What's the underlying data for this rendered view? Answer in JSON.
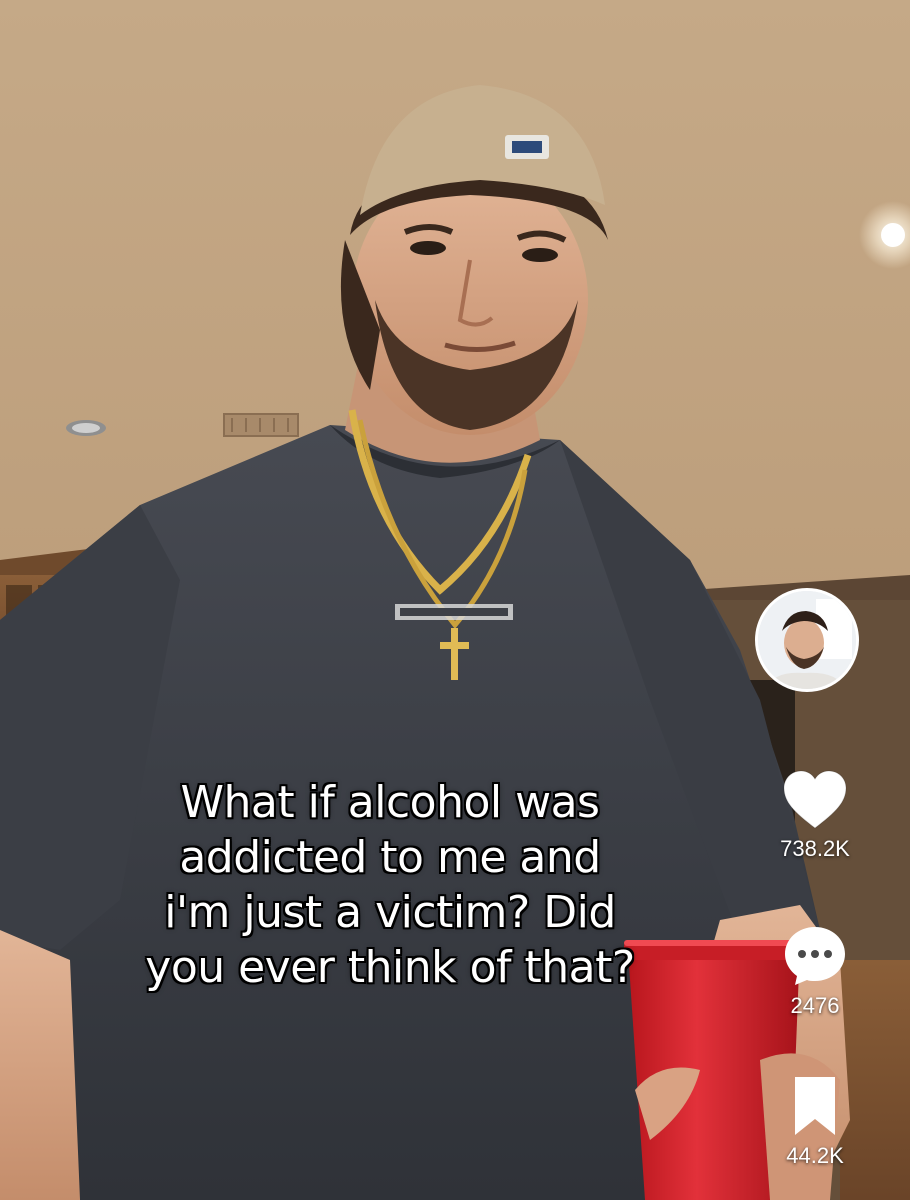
{
  "video": {
    "caption_lines": [
      "What if alcohol was",
      "addicted to me and",
      "i'm just a victim? Did",
      "you ever think of that?"
    ]
  },
  "rail": {
    "like": {
      "icon": "heart-icon",
      "count": "738.2K"
    },
    "comment": {
      "icon": "comment-bubble-icon",
      "count": "2476"
    },
    "save": {
      "icon": "bookmark-icon",
      "count": "44.2K"
    }
  },
  "colors": {
    "ceiling": "#c9ae8e",
    "shirt": "#3d4047",
    "cup": "#d8232a",
    "caption_text": "#ffffff",
    "caption_outline": "#000000"
  }
}
